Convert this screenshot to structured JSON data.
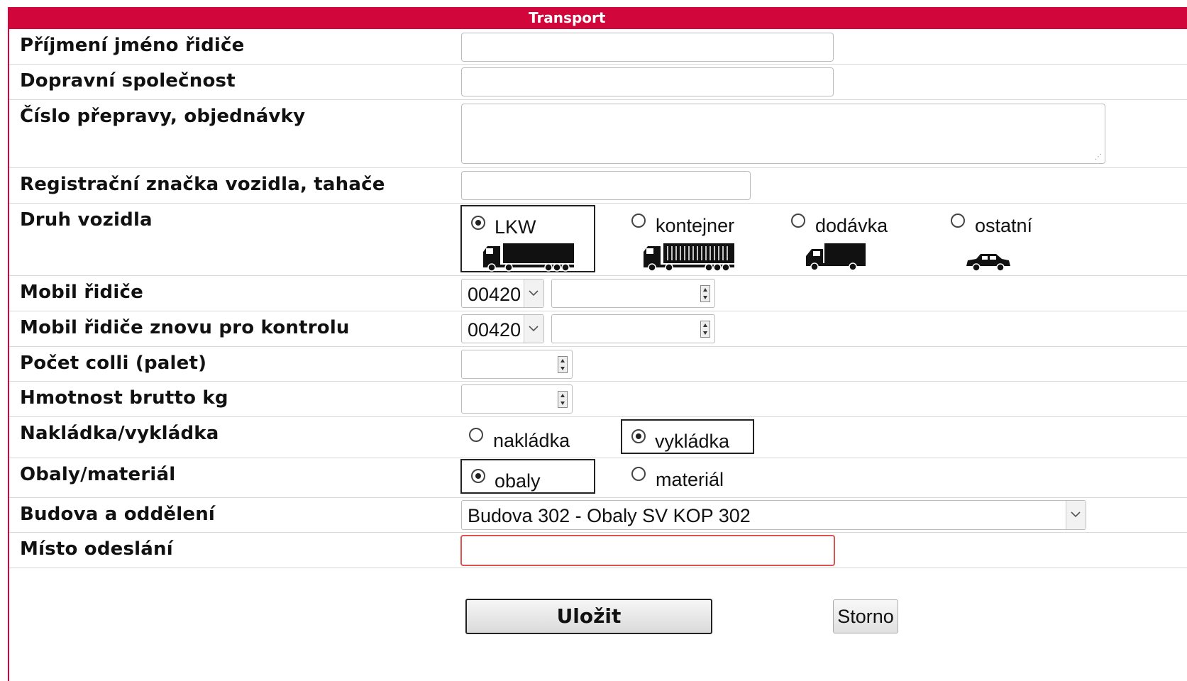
{
  "form": {
    "title": "Transport",
    "fields": {
      "driver_name": {
        "label": "Příjmení jméno řidiče",
        "value": ""
      },
      "company": {
        "label": "Dopravní společnost",
        "value": ""
      },
      "order_number": {
        "label": "Číslo přepravy, objednávky",
        "value": ""
      },
      "plate": {
        "label": "Registrační značka vozidla, tahače",
        "value": ""
      },
      "vehicle_type": {
        "label": "Druh vozidla",
        "options": [
          "LKW",
          "kontejner",
          "dodávka",
          "ostatní"
        ],
        "selected": "LKW"
      },
      "phone": {
        "label": "Mobil řidiče",
        "prefix": "00420",
        "number": ""
      },
      "phone_confirm": {
        "label": "Mobil řidiče znovu pro kontrolu",
        "prefix": "00420",
        "number": ""
      },
      "colli": {
        "label": "Počet colli (palet)",
        "value": ""
      },
      "weight": {
        "label": "Hmotnost brutto kg",
        "value": ""
      },
      "loading": {
        "label": "Nakládka/vykládka",
        "options": [
          "nakládka",
          "vykládka"
        ],
        "selected": "vykládka"
      },
      "material": {
        "label": "Obaly/materiál",
        "options": [
          "obaly",
          "materiál"
        ],
        "selected": "obaly"
      },
      "building": {
        "label": "Budova a oddělení",
        "value": "Budova 302 - Obaly SV KOP 302"
      },
      "origin": {
        "label": "Místo odeslání",
        "value": ""
      }
    },
    "buttons": {
      "save": "Uložit",
      "cancel": "Storno"
    },
    "colors": {
      "accent": "#d1063a",
      "error_border": "#d9534f"
    }
  }
}
